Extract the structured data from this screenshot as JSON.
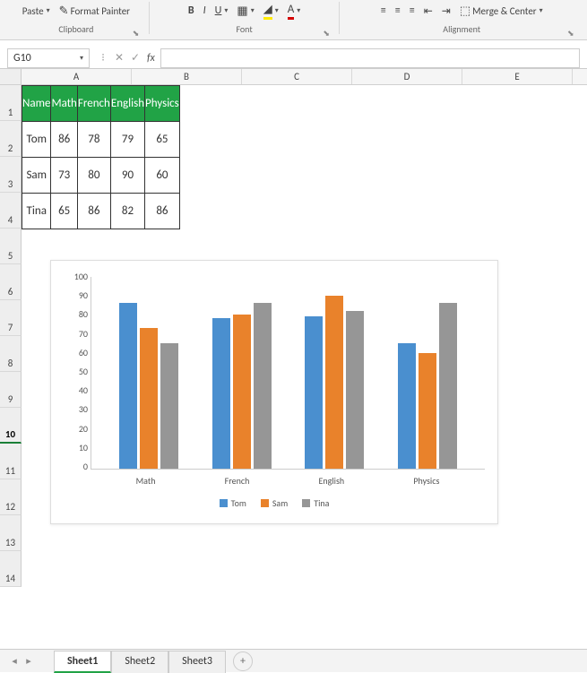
{
  "ribbon": {
    "paste": "Paste",
    "format_painter": "Format Painter",
    "clipboard_label": "Clipboard",
    "font_label": "Font",
    "alignment_label": "Alignment",
    "merge_label": "Merge & Center"
  },
  "formula_bar": {
    "cell_ref": "G10",
    "fx": "fx",
    "formula": ""
  },
  "columns": [
    "A",
    "B",
    "C",
    "D",
    "E"
  ],
  "rows": [
    "1",
    "2",
    "3",
    "4",
    "5",
    "6",
    "7",
    "8",
    "9",
    "10",
    "11",
    "12",
    "13",
    "14"
  ],
  "table": {
    "headers": [
      "Name",
      "Math",
      "French",
      "English",
      "Physics"
    ],
    "rows": [
      [
        "Tom",
        "86",
        "78",
        "79",
        "65"
      ],
      [
        "Sam",
        "73",
        "80",
        "90",
        "60"
      ],
      [
        "Tina",
        "65",
        "86",
        "82",
        "86"
      ]
    ]
  },
  "chart_data": {
    "type": "bar",
    "categories": [
      "Math",
      "French",
      "English",
      "Physics"
    ],
    "series": [
      {
        "name": "Tom",
        "values": [
          86,
          78,
          79,
          65
        ],
        "color": "#4a8fcf"
      },
      {
        "name": "Sam",
        "values": [
          73,
          80,
          90,
          60
        ],
        "color": "#e9822b"
      },
      {
        "name": "Tina",
        "values": [
          65,
          86,
          82,
          86
        ],
        "color": "#969696"
      }
    ],
    "ylim": [
      0,
      100
    ],
    "yticks": [
      0,
      10,
      20,
      30,
      40,
      50,
      60,
      70,
      80,
      90,
      100
    ],
    "xlabel": "",
    "ylabel": "",
    "title": ""
  },
  "sheets": {
    "tabs": [
      "Sheet1",
      "Sheet2",
      "Sheet3"
    ],
    "active": 0
  }
}
